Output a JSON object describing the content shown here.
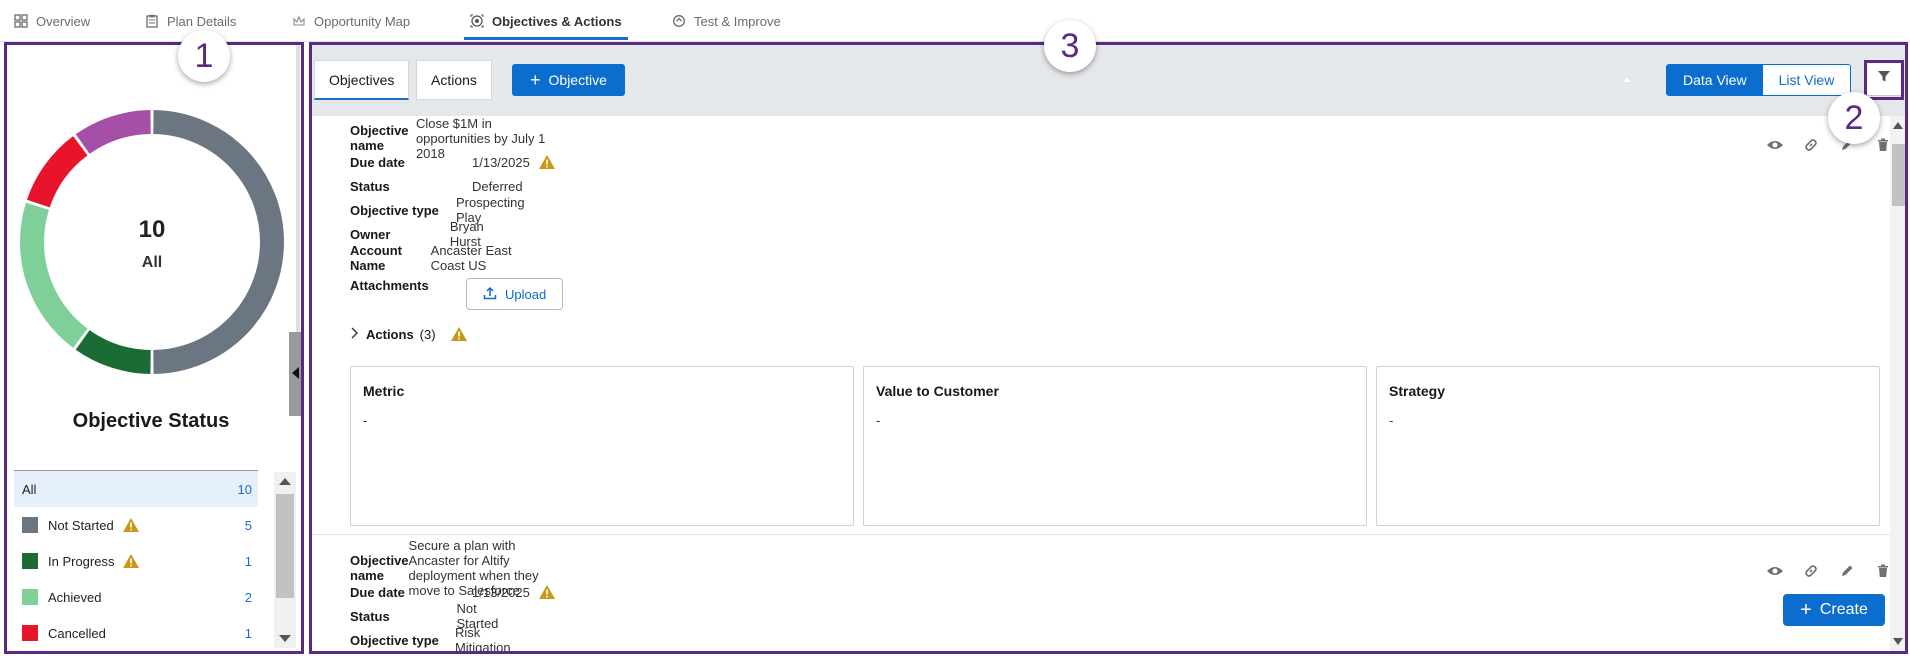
{
  "top_tabs": [
    {
      "label": "Overview",
      "icon": "grid-icon"
    },
    {
      "label": "Plan Details",
      "icon": "clipboard-icon"
    },
    {
      "label": "Opportunity Map",
      "icon": "crown-icon"
    },
    {
      "label": "Objectives & Actions",
      "icon": "target-icon",
      "active": true
    },
    {
      "label": "Test & Improve",
      "icon": "refresh-icon"
    }
  ],
  "callouts": [
    "1",
    "2",
    "3"
  ],
  "donut": {
    "count": "10",
    "label": "All",
    "segments": [
      {
        "status": "Not Started",
        "value": 5,
        "color": "#6b7682"
      },
      {
        "status": "In Progress",
        "value": 1,
        "color": "#1b6b35"
      },
      {
        "status": "Achieved",
        "value": 2,
        "color": "#7fcf98"
      },
      {
        "status": "Cancelled",
        "value": 1,
        "color": "#e8142b"
      },
      {
        "status": "Deferred",
        "value": 1,
        "color": "#a550a6"
      }
    ]
  },
  "status_panel": {
    "title": "Objective Status",
    "rows": [
      {
        "label": "All",
        "count": "10",
        "color": null,
        "warning": false
      },
      {
        "label": "Not Started",
        "count": "5",
        "color": "#6b7682",
        "warning": true
      },
      {
        "label": "In Progress",
        "count": "1",
        "color": "#1b6b35",
        "warning": true
      },
      {
        "label": "Achieved",
        "count": "2",
        "color": "#7fcf98",
        "warning": false
      },
      {
        "label": "Cancelled",
        "count": "1",
        "color": "#e8142b",
        "warning": false
      }
    ]
  },
  "toolbar": {
    "tab_objectives": "Objectives",
    "tab_actions": "Actions",
    "add_objective": "Objective",
    "data_view": "Data View",
    "list_view": "List View"
  },
  "labels": {
    "objective_name": "Objective name",
    "due_date": "Due date",
    "status": "Status",
    "objective_type": "Objective type",
    "owner": "Owner",
    "account_name": "Account Name",
    "attachments": "Attachments",
    "upload": "Upload",
    "actions": "Actions",
    "metric": "Metric",
    "value_to_customer": "Value to Customer",
    "strategy": "Strategy"
  },
  "objectives": [
    {
      "name": "Close $1M in opportunities by July 1 2018",
      "due_date": "1/13/2025",
      "status": "Deferred",
      "type": "Prospecting Play",
      "owner": "Bryan Hurst",
      "account": "Ancaster East Coast US",
      "actions_count": "(3)",
      "metric": "-",
      "value_to_customer": "-",
      "strategy": "-"
    },
    {
      "name": "Secure a plan with Ancaster for Altify deployment when they move to Salesforce",
      "due_date": "1/13/2025",
      "status": "Not Started",
      "type": "Risk Mitigation"
    }
  ],
  "create_button": "Create",
  "colors": {
    "accent": "#0b6dce",
    "callout": "#5a2a82",
    "warning": "#c9981b"
  }
}
